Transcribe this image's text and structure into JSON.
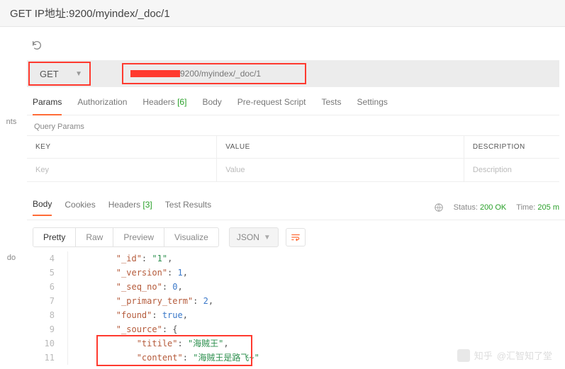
{
  "topbar": {
    "cmd": "GET  IP地址:9200/myindex/_doc/1"
  },
  "request": {
    "method": "GET",
    "url_suffix": "9200/myindex/_doc/1"
  },
  "req_tabs": {
    "params": "Params",
    "auth": "Authorization",
    "headers": "Headers",
    "headers_count": "[6]",
    "body": "Body",
    "prerequest": "Pre-request Script",
    "tests": "Tests",
    "settings": "Settings"
  },
  "query_params": {
    "title": "Query Params",
    "head_key": "KEY",
    "head_value": "VALUE",
    "head_desc": "DESCRIPTION",
    "ph_key": "Key",
    "ph_value": "Value",
    "ph_desc": "Description"
  },
  "resp_tabs": {
    "body": "Body",
    "cookies": "Cookies",
    "headers": "Headers",
    "headers_count": "[3]",
    "test_results": "Test Results"
  },
  "status": {
    "label": "Status:",
    "code": "200 OK",
    "time_label": "Time:",
    "time_value": "205 m"
  },
  "body_toolbar": {
    "pretty": "Pretty",
    "raw": "Raw",
    "preview": "Preview",
    "visualize": "Visualize",
    "format": "JSON"
  },
  "code_lines": [
    {
      "n": 4,
      "indent": 2,
      "k": "_id",
      "t": "str",
      "v": "1",
      "comma": true
    },
    {
      "n": 5,
      "indent": 2,
      "k": "_version",
      "t": "num",
      "v": "1",
      "comma": true
    },
    {
      "n": 6,
      "indent": 2,
      "k": "_seq_no",
      "t": "num",
      "v": "0",
      "comma": true
    },
    {
      "n": 7,
      "indent": 2,
      "k": "_primary_term",
      "t": "num",
      "v": "2",
      "comma": true
    },
    {
      "n": 8,
      "indent": 2,
      "k": "found",
      "t": "bool",
      "v": "true",
      "comma": true
    },
    {
      "n": 9,
      "indent": 2,
      "k": "_source",
      "t": "open",
      "v": "{",
      "comma": false
    },
    {
      "n": 10,
      "indent": 3,
      "k": "titile",
      "t": "str",
      "v": "海贼王",
      "comma": true
    },
    {
      "n": 11,
      "indent": 3,
      "k": "content",
      "t": "str",
      "v": "海贼王是路飞~",
      "comma": false
    }
  ],
  "sidecut": {
    "nts": "nts",
    "do": "do"
  },
  "watermark": {
    "prefix": "知乎",
    "handle": "@汇智知了堂"
  }
}
